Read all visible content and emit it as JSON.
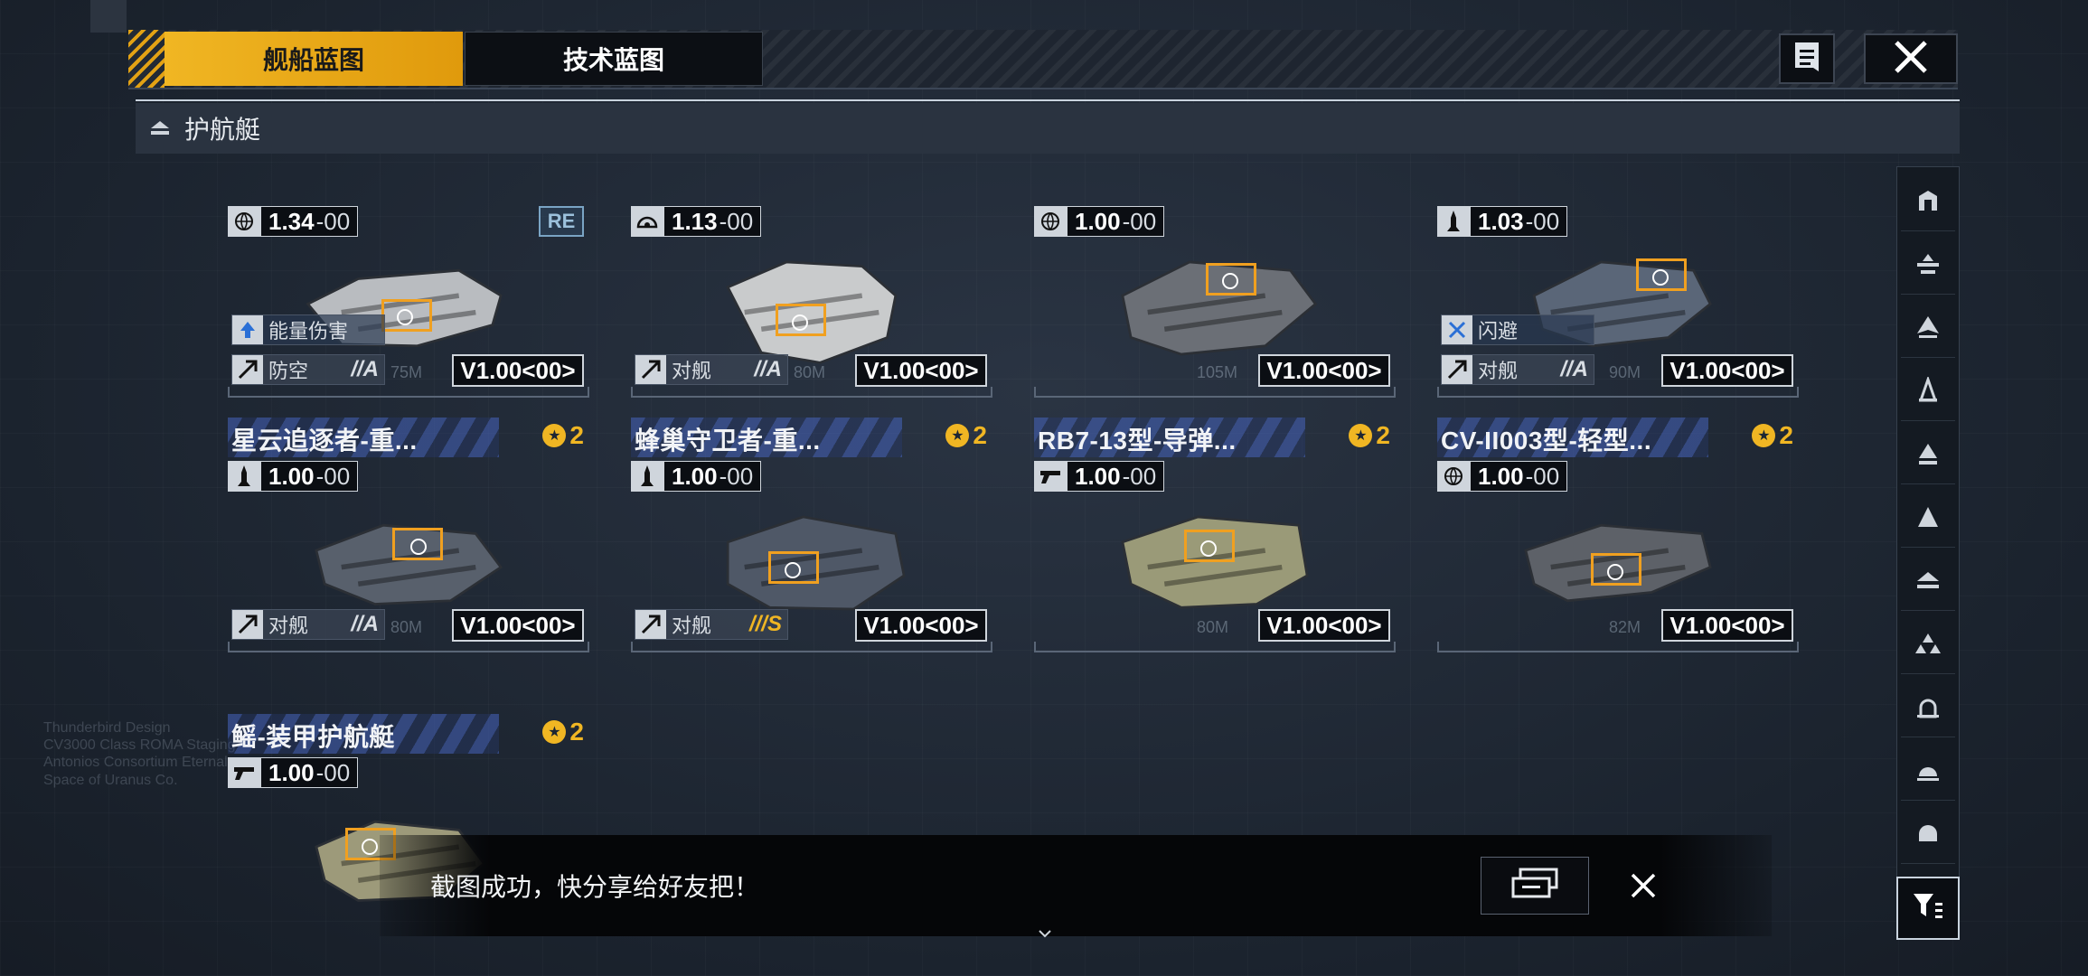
{
  "header": {
    "tabs": [
      {
        "label": "舰船蓝图",
        "active": true
      },
      {
        "label": "技术蓝图",
        "active": false
      }
    ],
    "doc_icon": "document-icon",
    "close_icon": "close-icon"
  },
  "category": {
    "label": "护航艇",
    "icon": "escort-ship-icon"
  },
  "colors": {
    "accent": "#f0b623",
    "panel": "#1d2633",
    "rail": "#141a22"
  },
  "ships": [
    {
      "name": "",
      "rank": "",
      "ver_main": "1.34",
      "ver_dec": "00",
      "type_icon": "globe-icon",
      "badge": "RE",
      "ability": "能量伤害",
      "ability_icon": "arrow-up-icon",
      "role": "防空",
      "grade": "A",
      "version": "V1.00<00>",
      "length": "75M"
    },
    {
      "name": "",
      "rank": "",
      "ver_main": "1.13",
      "ver_dec": "00",
      "type_icon": "radar-icon",
      "badge": "",
      "ability": "",
      "ability_icon": "",
      "role": "对舰",
      "grade": "A",
      "version": "V1.00<00>",
      "length": "80M"
    },
    {
      "name": "",
      "rank": "",
      "ver_main": "1.00",
      "ver_dec": "00",
      "type_icon": "globe-icon",
      "badge": "",
      "ability": "",
      "ability_icon": "",
      "role": "",
      "grade": "",
      "version": "V1.00<00>",
      "length": "105M"
    },
    {
      "name": "",
      "rank": "",
      "ver_main": "1.03",
      "ver_dec": "00",
      "type_icon": "missile-icon",
      "badge": "",
      "ability": "闪避",
      "ability_icon": "dodge-icon",
      "role": "对舰",
      "grade": "A",
      "version": "V1.00<00>",
      "length": "90M"
    },
    {
      "name": "星云追逐者-重...",
      "rank": "2",
      "ver_main": "1.00",
      "ver_dec": "00",
      "type_icon": "missile-icon",
      "badge": "",
      "ability": "",
      "ability_icon": "",
      "role": "对舰",
      "grade": "A",
      "version": "V1.00<00>",
      "length": "80M"
    },
    {
      "name": "蜂巢守卫者-重...",
      "rank": "2",
      "ver_main": "1.00",
      "ver_dec": "00",
      "type_icon": "missile-icon",
      "badge": "",
      "ability": "",
      "ability_icon": "",
      "role": "对舰",
      "grade": "S",
      "version": "V1.00<00>",
      "length": ""
    },
    {
      "name": "RB7-13型-导弹...",
      "rank": "2",
      "ver_main": "1.00",
      "ver_dec": "00",
      "type_icon": "gun-icon",
      "badge": "",
      "ability": "",
      "ability_icon": "",
      "role": "",
      "grade": "",
      "version": "V1.00<00>",
      "length": "80M"
    },
    {
      "name": "CV-II003型-轻型...",
      "rank": "2",
      "ver_main": "1.00",
      "ver_dec": "00",
      "type_icon": "globe-icon",
      "badge": "",
      "ability": "",
      "ability_icon": "",
      "role": "",
      "grade": "",
      "version": "V1.00<00>",
      "length": "82M"
    },
    {
      "name": "鳐-装甲护航艇",
      "rank": "2",
      "ver_main": "1.00",
      "ver_dec": "00",
      "type_icon": "gun-icon",
      "badge": "",
      "ability": "",
      "ability_icon": "",
      "role": "",
      "grade": "",
      "version": "",
      "length": ""
    }
  ],
  "rail_icons": [
    "battleship-icon",
    "carrier-icon",
    "cruiser-icon",
    "destroyer-icon",
    "frigate-icon",
    "corvette-icon",
    "escort-icon",
    "fighter-icon",
    "utility-icon",
    "dome-icon",
    "capsule-icon"
  ],
  "filter_icon": "filter-icon",
  "toast": {
    "message": "截图成功，快分享给好友把！",
    "share_icon": "share-icon",
    "close_icon": "close-icon"
  }
}
